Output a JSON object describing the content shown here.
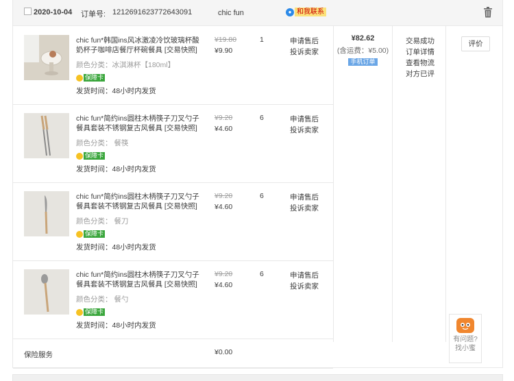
{
  "order": {
    "date": "2020-10-04",
    "order_no_label": "订单号:",
    "order_no": "1212691623772643091",
    "shop": "chic fun",
    "contact_label": "和我联系",
    "contact_icon": "chat-bubble-icon",
    "delete_icon": "trash-icon"
  },
  "items": [
    {
      "title": "chic fun*韩国ins风冰激凌冷饮玻璃杯酸奶杯子咖啡店餐厅杯碗餐具 [交易快照]",
      "attr": "颜色分类：冰淇淋杯【180ml】",
      "badge": "保障卡",
      "ship": "发货时间：48小时内发货",
      "orig_price": "¥19.80",
      "price": "¥9.90",
      "qty": "1",
      "svc1": "申请售后",
      "svc2": "投诉卖家"
    },
    {
      "title": "chic fun*简约ins圆柱木柄筷子刀叉勺子餐具套装不锈钢复古风餐具 [交易快照]",
      "attr": "颜色分类：   餐筷",
      "badge": "保障卡",
      "ship": "发货时间：48小时内发货",
      "orig_price": "¥9.20",
      "price": "¥4.60",
      "qty": "6",
      "svc1": "申请售后",
      "svc2": "投诉卖家"
    },
    {
      "title": "chic fun*简约ins圆柱木柄筷子刀叉勺子餐具套装不锈钢复古风餐具 [交易快照]",
      "attr": "颜色分类：   餐刀",
      "badge": "保障卡",
      "ship": "发货时间：48小时内发货",
      "orig_price": "¥9.20",
      "price": "¥4.60",
      "qty": "6",
      "svc1": "申请售后",
      "svc2": "投诉卖家"
    },
    {
      "title": "chic fun*简约ins圆柱木柄筷子刀叉勺子餐具套装不锈钢复古风餐具 [交易快照]",
      "attr": "颜色分类：   餐勺",
      "badge": "保障卡",
      "ship": "发货时间：48小时内发货",
      "orig_price": "¥9.20",
      "price": "¥4.60",
      "qty": "6",
      "svc1": "申请售后",
      "svc2": "投诉卖家"
    }
  ],
  "insurance": {
    "label": "保险服务",
    "price": "¥0.00"
  },
  "summary": {
    "total": "¥82.62",
    "shipping": "(含运费：¥5.00)",
    "mobile_tag": "手机订单"
  },
  "status": {
    "state": "交易成功",
    "detail": "订单详情",
    "logistics": "查看物流",
    "rated": "对方已评"
  },
  "actions": {
    "evaluate": "评价"
  },
  "helper": {
    "line1": "有问题?",
    "line2": "找小蜜"
  },
  "colors": {
    "header_bg": "#f5f5f5",
    "border": "#e8e8e8",
    "badge_green": "#3aa63c",
    "contact_yellow": "#fbe27a",
    "contact_red": "#cc0000",
    "mobile_blue": "#6aa6e6"
  }
}
